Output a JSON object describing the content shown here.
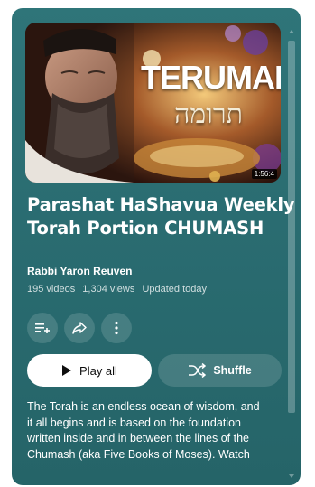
{
  "thumbnail": {
    "overlay_title": "TERUMAH",
    "overlay_hebrew": "תרומה",
    "duration": "1:56:4"
  },
  "playlist": {
    "title_line1": "Parashat HaShavua Weekly",
    "title_line2": "Torah Portion CHUMASH",
    "channel": "Rabbi Yaron Reuven",
    "video_count": "195 videos",
    "view_count": "1,304 views",
    "updated": "Updated today"
  },
  "actions": {
    "save_icon": "playlist-add-icon",
    "share_icon": "share-icon",
    "more_icon": "more-vert-icon",
    "play_all_label": "Play all",
    "shuffle_label": "Shuffle"
  },
  "description": {
    "lines": [
      "The Torah is an endless ocean of wisdom, and",
      "it all begins and is based on the foundation",
      "written inside and in between the lines of the",
      "Chumash (aka Five Books of Moses).  Watch"
    ]
  },
  "colors": {
    "panel_bg": "#2a6c71",
    "play_button_bg": "#ffffff",
    "text": "#ffffff"
  }
}
